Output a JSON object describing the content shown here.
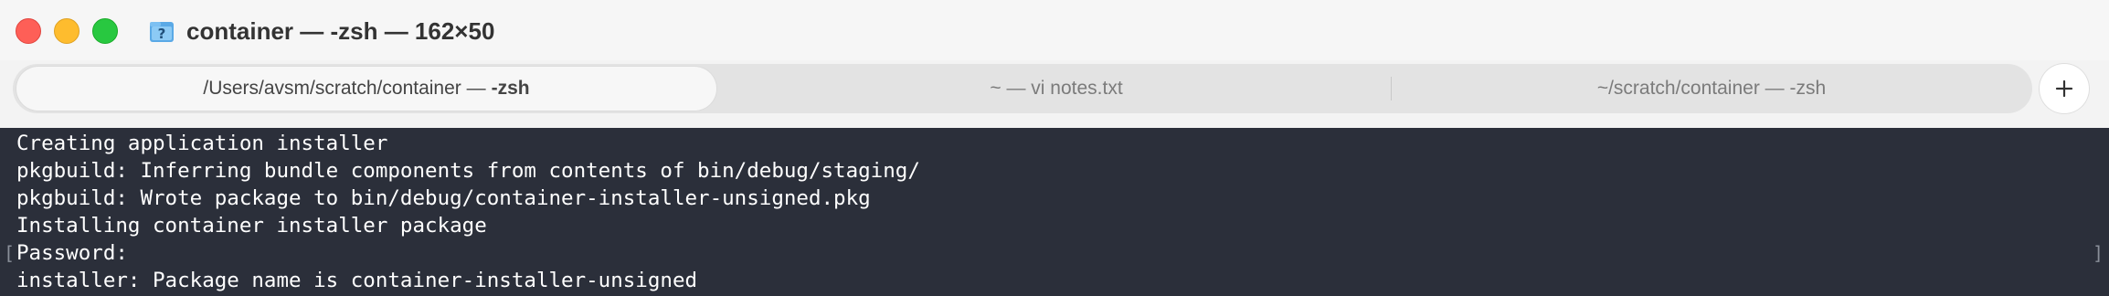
{
  "window": {
    "title": "container — -zsh — 162×50",
    "title_icon": "folder-question-icon"
  },
  "tabs": [
    {
      "path": "/Users/avsm/scratch/container —",
      "process": "-zsh",
      "active": true
    },
    {
      "label": "~ — vi notes.txt",
      "active": false
    },
    {
      "label": "~/scratch/container — -zsh",
      "active": false
    }
  ],
  "new_tab_icon": "plus-icon",
  "terminal": {
    "lines": [
      "Creating application installer",
      "pkgbuild: Inferring bundle components from contents of bin/debug/staging/",
      "pkgbuild: Wrote package to bin/debug/container-installer-unsigned.pkg",
      "Installing container installer package",
      "Password:",
      "installer: Package name is container-installer-unsigned"
    ],
    "left_marker": "[",
    "right_marker": "]"
  },
  "colors": {
    "terminal_bg": "#2b2f3a",
    "terminal_fg": "#ffffff",
    "close": "#fe5f57",
    "minimize": "#febc2e",
    "zoom": "#28c840"
  }
}
